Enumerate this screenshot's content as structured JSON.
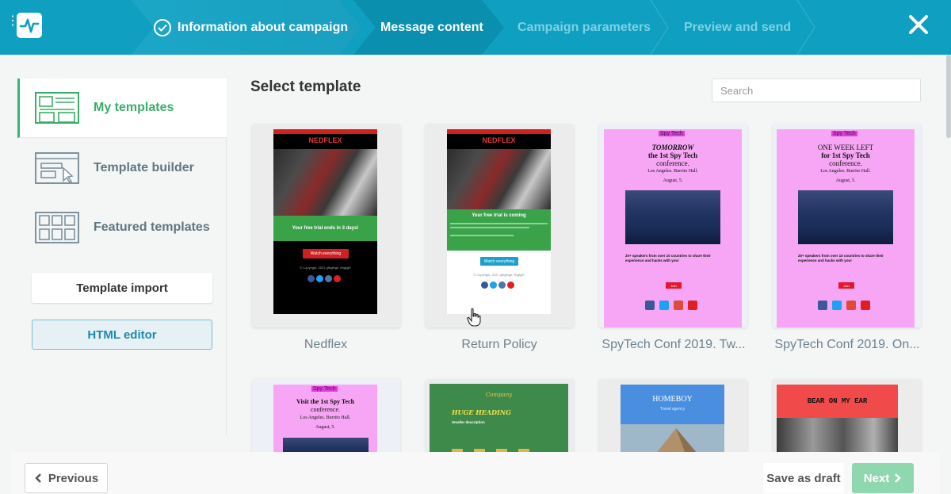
{
  "header": {
    "steps": [
      {
        "label": "Information about campaign",
        "state": "done"
      },
      {
        "label": "Message content",
        "state": "active"
      },
      {
        "label": "Campaign parameters",
        "state": "upcoming"
      },
      {
        "label": "Preview and send",
        "state": "upcoming"
      }
    ],
    "close_icon": "close-icon",
    "logo_icon": "pulse-icon"
  },
  "sidebar": {
    "items": [
      {
        "label": "My templates",
        "icon": "templates-icon",
        "active": true
      },
      {
        "label": "Template builder",
        "icon": "builder-icon",
        "active": false
      },
      {
        "label": "Featured templates",
        "icon": "grid-icon",
        "active": false
      }
    ],
    "import_label": "Template import",
    "html_editor_label": "HTML editor"
  },
  "main": {
    "title": "Select template",
    "search_placeholder": "Search",
    "templates": [
      {
        "name": "Nedflex",
        "brand": "NEDFLEX",
        "banner": "Your free trial ends in 3 days!",
        "button": "Watch everything",
        "copyright": "© Copyright, 2021 gfhgfhgh, tfhgtgfh"
      },
      {
        "name": "Return Policy",
        "brand": "NEDFLEX",
        "banner": "Your free trial is coming",
        "button": "Watch everything",
        "copyright": "© Copyright, 2021 gfhgfhgh, tfhgtgfh"
      },
      {
        "name": "SpyTech Conf 2019. Tw...",
        "tag": "Spy Tech",
        "line1": "TOMORROW",
        "line2": "the 1st Spy Tech",
        "line3": "conference.",
        "venue": "Los Angeles. Burrito Hall.",
        "date": "August, 5.",
        "speakers": "20+ speakers from over 10 countries to share their experience and hacks with you!",
        "cta": "Join"
      },
      {
        "name": "SpyTech Conf 2019. On...",
        "tag": "Spy Tech",
        "line1": "ONE WEEK LEFT",
        "line2": "for 1st Spy Tech",
        "line3": "conference.",
        "venue": "Los Angeles. Burrito Hall.",
        "date": "August, 5.",
        "speakers": "20+ speakers from over 10 countries to share their experience and hacks with you!",
        "cta": "Join"
      },
      {
        "tag": "Spy Tech",
        "line1": "Visit the 1st Spy Tech",
        "line2": "conference.",
        "venue": "Los Angeles. Burrito Hall.",
        "date": "August, 5."
      },
      {
        "script_title": "Company",
        "heading": "HUGE HEADING",
        "sub": "Smaller description"
      },
      {
        "heading": "HOMEBOY",
        "sub": "Travel agency"
      },
      {
        "heading": "BEAR ON MY EAR"
      }
    ]
  },
  "footer": {
    "previous_label": "Previous",
    "draft_label": "Save as draft",
    "next_label": "Next"
  },
  "colors": {
    "header": "#0f9fc0",
    "accent_green": "#3aae66",
    "next_button": "#8fd7ae",
    "html_button_text": "#1c8ca8"
  }
}
